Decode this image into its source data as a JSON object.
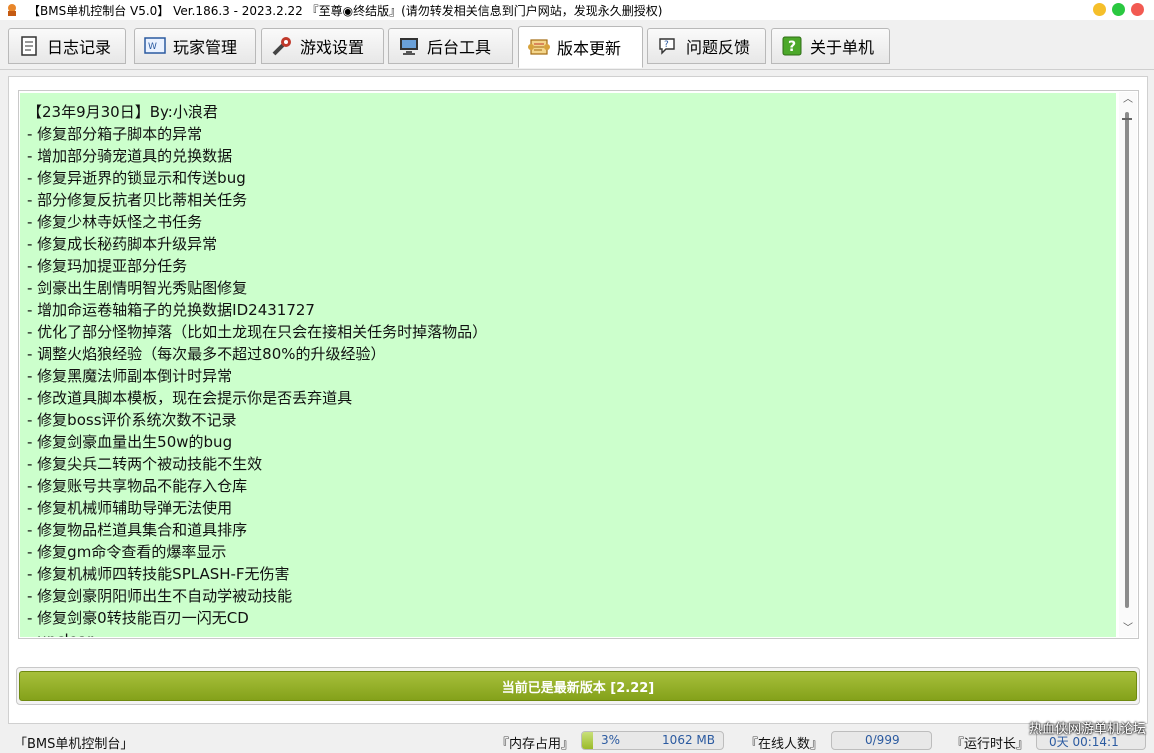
{
  "window": {
    "title": "【BMS单机控制台 V5.0】 Ver.186.3 - 2023.2.22 『至尊◉终结版』(请勿转发相关信息到门户网站，发现永久删授权)"
  },
  "tabs": [
    {
      "label": "日志记录",
      "icon": "notebook-icon"
    },
    {
      "label": "玩家管理",
      "icon": "web-browser-icon"
    },
    {
      "label": "游戏设置",
      "icon": "wrench-icon"
    },
    {
      "label": "后台工具",
      "icon": "computer-icon"
    },
    {
      "label": "版本更新",
      "icon": "scroll-icon"
    },
    {
      "label": "问题反馈",
      "icon": "feedback-icon"
    },
    {
      "label": "关于单机",
      "icon": "help-icon"
    }
  ],
  "active_tab": "版本更新",
  "changelog": {
    "lines": [
      "【23年9月30日】By:小浪君",
      "- 修复部分箱子脚本的异常",
      "- 增加部分骑宠道具的兑换数据",
      "- 修复异逝界的锁显示和传送bug",
      "- 部分修复反抗者贝比蒂相关任务",
      "- 修复少林寺妖怪之书任务",
      "- 修复成长秘药脚本升级异常",
      "- 修复玛加提亚部分任务",
      "- 剑豪出生剧情明智光秀贴图修复",
      "- 增加命运卷轴箱子的兑换数据ID2431727",
      "- 优化了部分怪物掉落（比如土龙现在只会在接相关任务时掉落物品）",
      "- 调整火焰狼经验（每次最多不超过80%的升级经验）",
      "- 修复黑魔法师副本倒计时异常",
      "- 修改道具脚本模板，现在会提示你是否丢弃道具",
      "- 修复boss评价系统次数不记录",
      "- 修复剑豪血量出生50w的bug",
      "- 修复尖兵二转两个被动技能不生效",
      "- 修复账号共享物品不能存入仓库",
      "- 修复机械师辅助导弹无法使用",
      "- 修复物品栏道具集合和道具排序",
      "- 修复gm命令查看的爆率显示",
      "- 修复机械师四转技能SPLASH-F无伤害",
      "- 修复剑豪阴阳师出生不自动学被动技能",
      "- 修复剑豪0转技能百刃一闪无CD",
      "- unclear"
    ]
  },
  "update_status": "当前已是最新版本 [2.22]",
  "statusbar": {
    "app_label": "「BMS单机控制台」",
    "memory_label": "『内存占用』",
    "memory_percent_text": "3%",
    "memory_percent": 3,
    "memory_mb": "1062 MB",
    "online_label": "『在线人数』",
    "online_count": "0/999",
    "runtime_label": "『运行时长』",
    "runtime_value": "0天 00:14:1"
  },
  "watermark": "热血侠网游单机论坛",
  "colors": {
    "log_background": "#ccffcc",
    "status_button": "#93ad26",
    "progress_fill": "#a8c43a"
  }
}
